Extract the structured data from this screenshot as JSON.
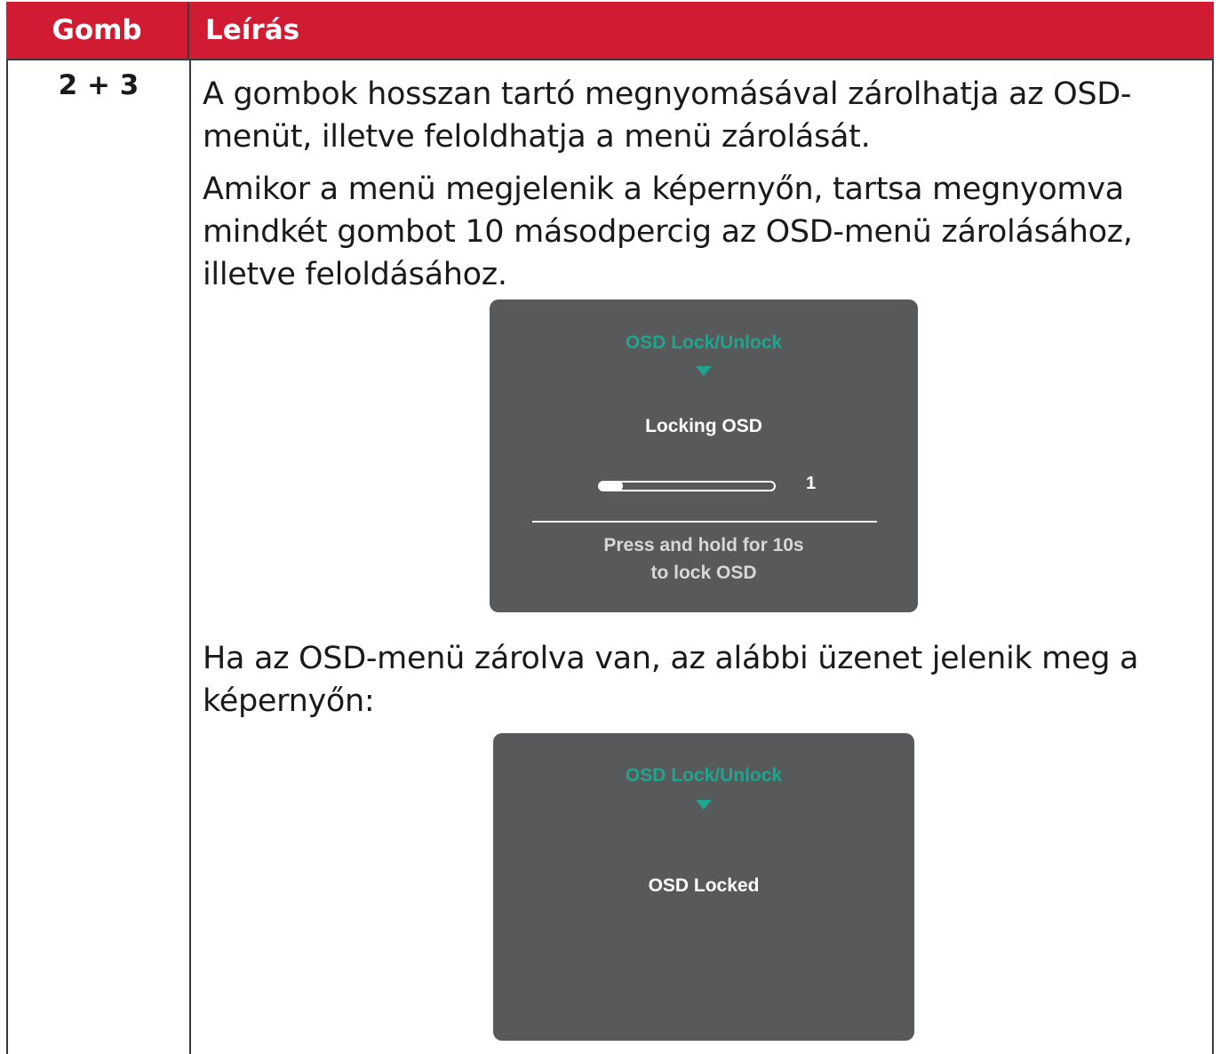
{
  "table": {
    "header": {
      "col_key": "Gomb",
      "col_desc": "Leírás"
    },
    "row": {
      "key": "2 + 3",
      "paragraph_1": "A gombok hosszan tartó megnyomásával zárolhatja az OSD-menüt, illetve feloldhatja a menü zárolását.",
      "paragraph_2": "Amikor a menü megjelenik a képernyőn, tartsa megnyomva mindkét gombot 10 másodpercig az OSD-menü zárolásához, illetve feloldásához.",
      "paragraph_3": "Ha az OSD-menü zárolva van, az alábbi üzenet jelenik meg a képernyőn:"
    }
  },
  "osd_locking": {
    "title": "OSD Lock/Unlock",
    "status": "Locking OSD",
    "slider_value": "1",
    "slider_fraction": 0.1,
    "hint_line_1": "Press and hold for 10s",
    "hint_line_2": "to lock OSD"
  },
  "osd_locked": {
    "title": "OSD Lock/Unlock",
    "status": "OSD Locked"
  },
  "colors": {
    "header_bg": "#d11b33",
    "osd_bg": "#58595b",
    "osd_accent": "#1fa58e"
  }
}
